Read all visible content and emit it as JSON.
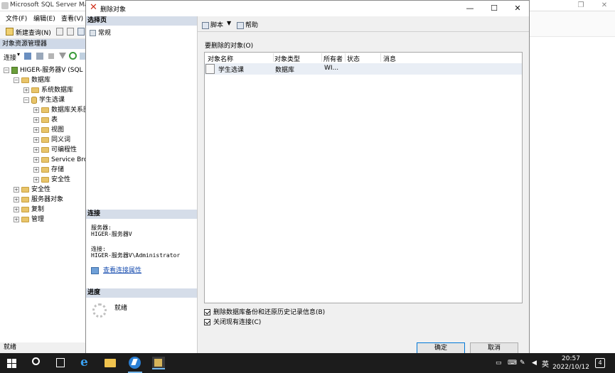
{
  "ssms": {
    "title": "Microsoft SQL Server Mana",
    "menu": [
      "文件(F)",
      "编辑(E)",
      "查看(V)"
    ],
    "toolbar_new_query": "新建查询(N)",
    "oe_title": "对象资源管理器",
    "oe_connect": "连接",
    "tree": [
      {
        "label": "HIGER-服务器V (SQL S",
        "icon": "server"
      },
      {
        "label": "数据库",
        "icon": "folder"
      },
      {
        "label": "系统数据库",
        "icon": "folder"
      },
      {
        "label": "学生选课",
        "icon": "database"
      },
      {
        "label": "数据库关系图",
        "icon": "folder"
      },
      {
        "label": "表",
        "icon": "folder"
      },
      {
        "label": "视图",
        "icon": "folder"
      },
      {
        "label": "同义词",
        "icon": "folder"
      },
      {
        "label": "可编程性",
        "icon": "folder"
      },
      {
        "label": "Service Brok",
        "icon": "folder"
      },
      {
        "label": "存储",
        "icon": "folder"
      },
      {
        "label": "安全性",
        "icon": "folder"
      },
      {
        "label": "安全性",
        "icon": "folder"
      },
      {
        "label": "服务器对象",
        "icon": "folder"
      },
      {
        "label": "复制",
        "icon": "folder"
      },
      {
        "label": "管理",
        "icon": "folder"
      }
    ],
    "status": "就绪"
  },
  "dialog": {
    "title": "删除对象",
    "left": {
      "select_page_header": "选择页",
      "page_general": "常规",
      "connection_header": "连接",
      "server_label": "服务器:",
      "server_value": "HIGER-服务器V",
      "connection_label": "连接:",
      "connection_value": "HIGER-服务器V\\Administrator",
      "view_connection_props": "查看连接属性",
      "progress_header": "进度",
      "progress_status": "就绪"
    },
    "toolbar": {
      "script": "脚本",
      "help": "帮助"
    },
    "objects_caption": "要删除的对象(O)",
    "columns": [
      "对象名称",
      "对象类型",
      "所有者",
      "状态",
      "消息"
    ],
    "rows": [
      {
        "name": "学生选课",
        "type": "数据库",
        "owner": "WI...",
        "status": "",
        "message": ""
      }
    ],
    "checkbox_backup_history": {
      "label": "删除数据库备份和还原历史记录信息(B)",
      "checked": true
    },
    "checkbox_close_connections": {
      "label": "关闭现有连接(C)",
      "checked": true
    },
    "ok_button": "确定",
    "cancel_button": "取消"
  },
  "taskbar": {
    "time": "20:57",
    "date": "2022/10/12",
    "ime": "英",
    "notification_count": "4"
  }
}
